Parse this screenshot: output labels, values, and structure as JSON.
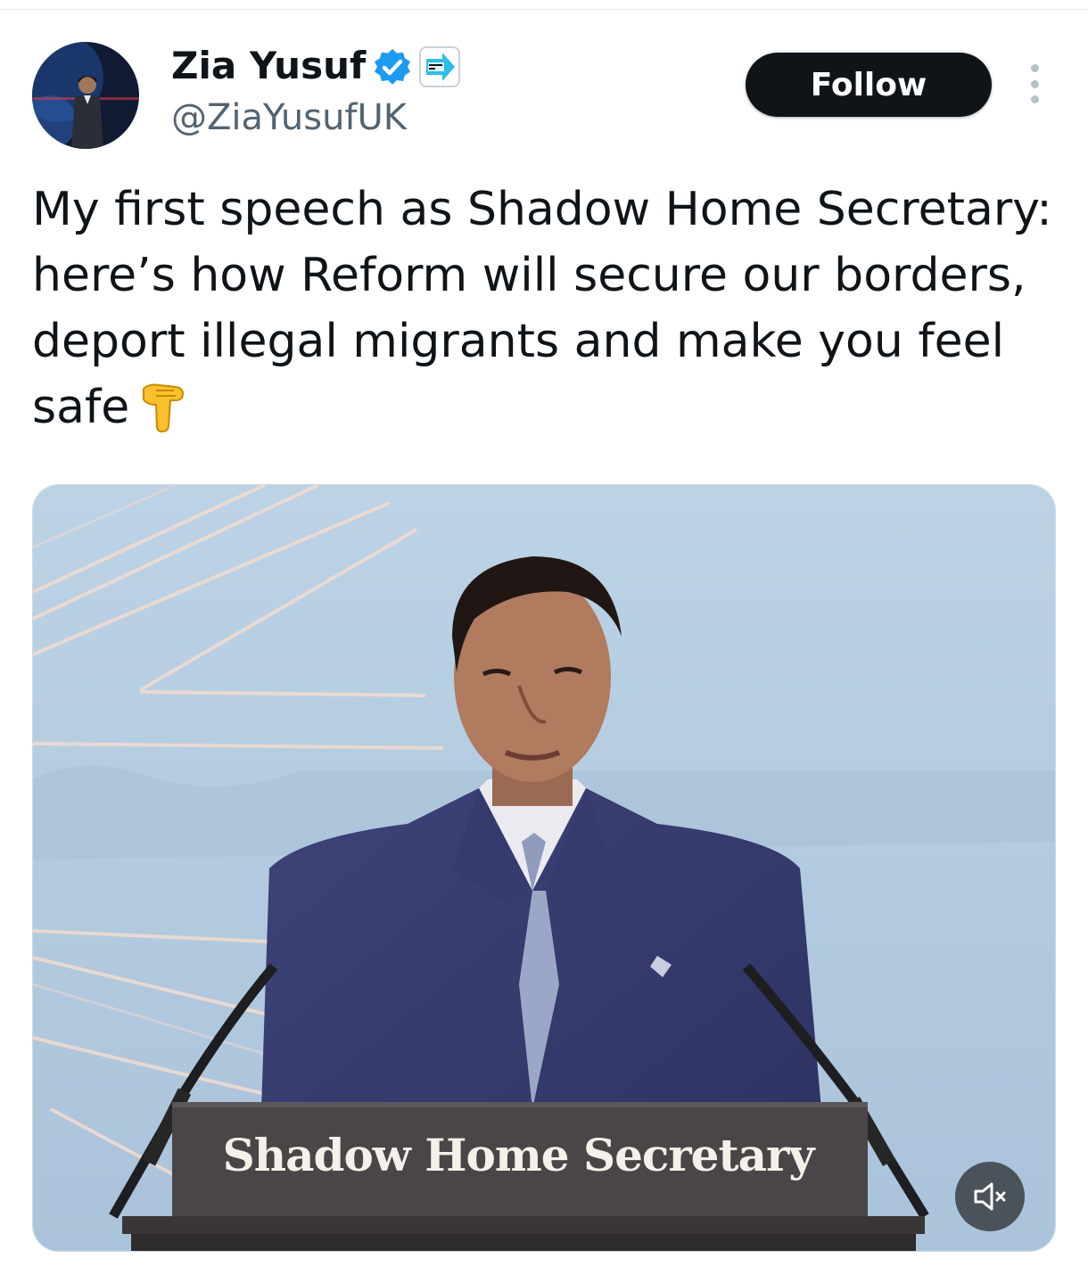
{
  "author": {
    "display_name": "Zia Yusuf",
    "handle": "@ZiaYusufUK",
    "verified_icon": "verified-badge-icon",
    "affiliate_icon": "reform-uk-affiliate-icon",
    "avatar": "avatar-image"
  },
  "actions": {
    "follow_label": "Follow",
    "more_icon": "more-options-icon"
  },
  "tweet": {
    "text": "My first speech as Shadow Home Secretary: here’s how Reform will secure our borders, deport illegal migrants and make you feel safe",
    "emoji": "backhand-index-pointing-down-icon"
  },
  "media": {
    "type": "video",
    "podium_sign": "Shadow Home Secretary",
    "mute_icon": "muted-speaker-icon"
  },
  "colors": {
    "text": "#0f1419",
    "secondary_text": "#536471",
    "verified_blue": "#1d9bf0",
    "follow_bg": "#0f1419",
    "backdrop_blue": "#b9d0e3"
  }
}
